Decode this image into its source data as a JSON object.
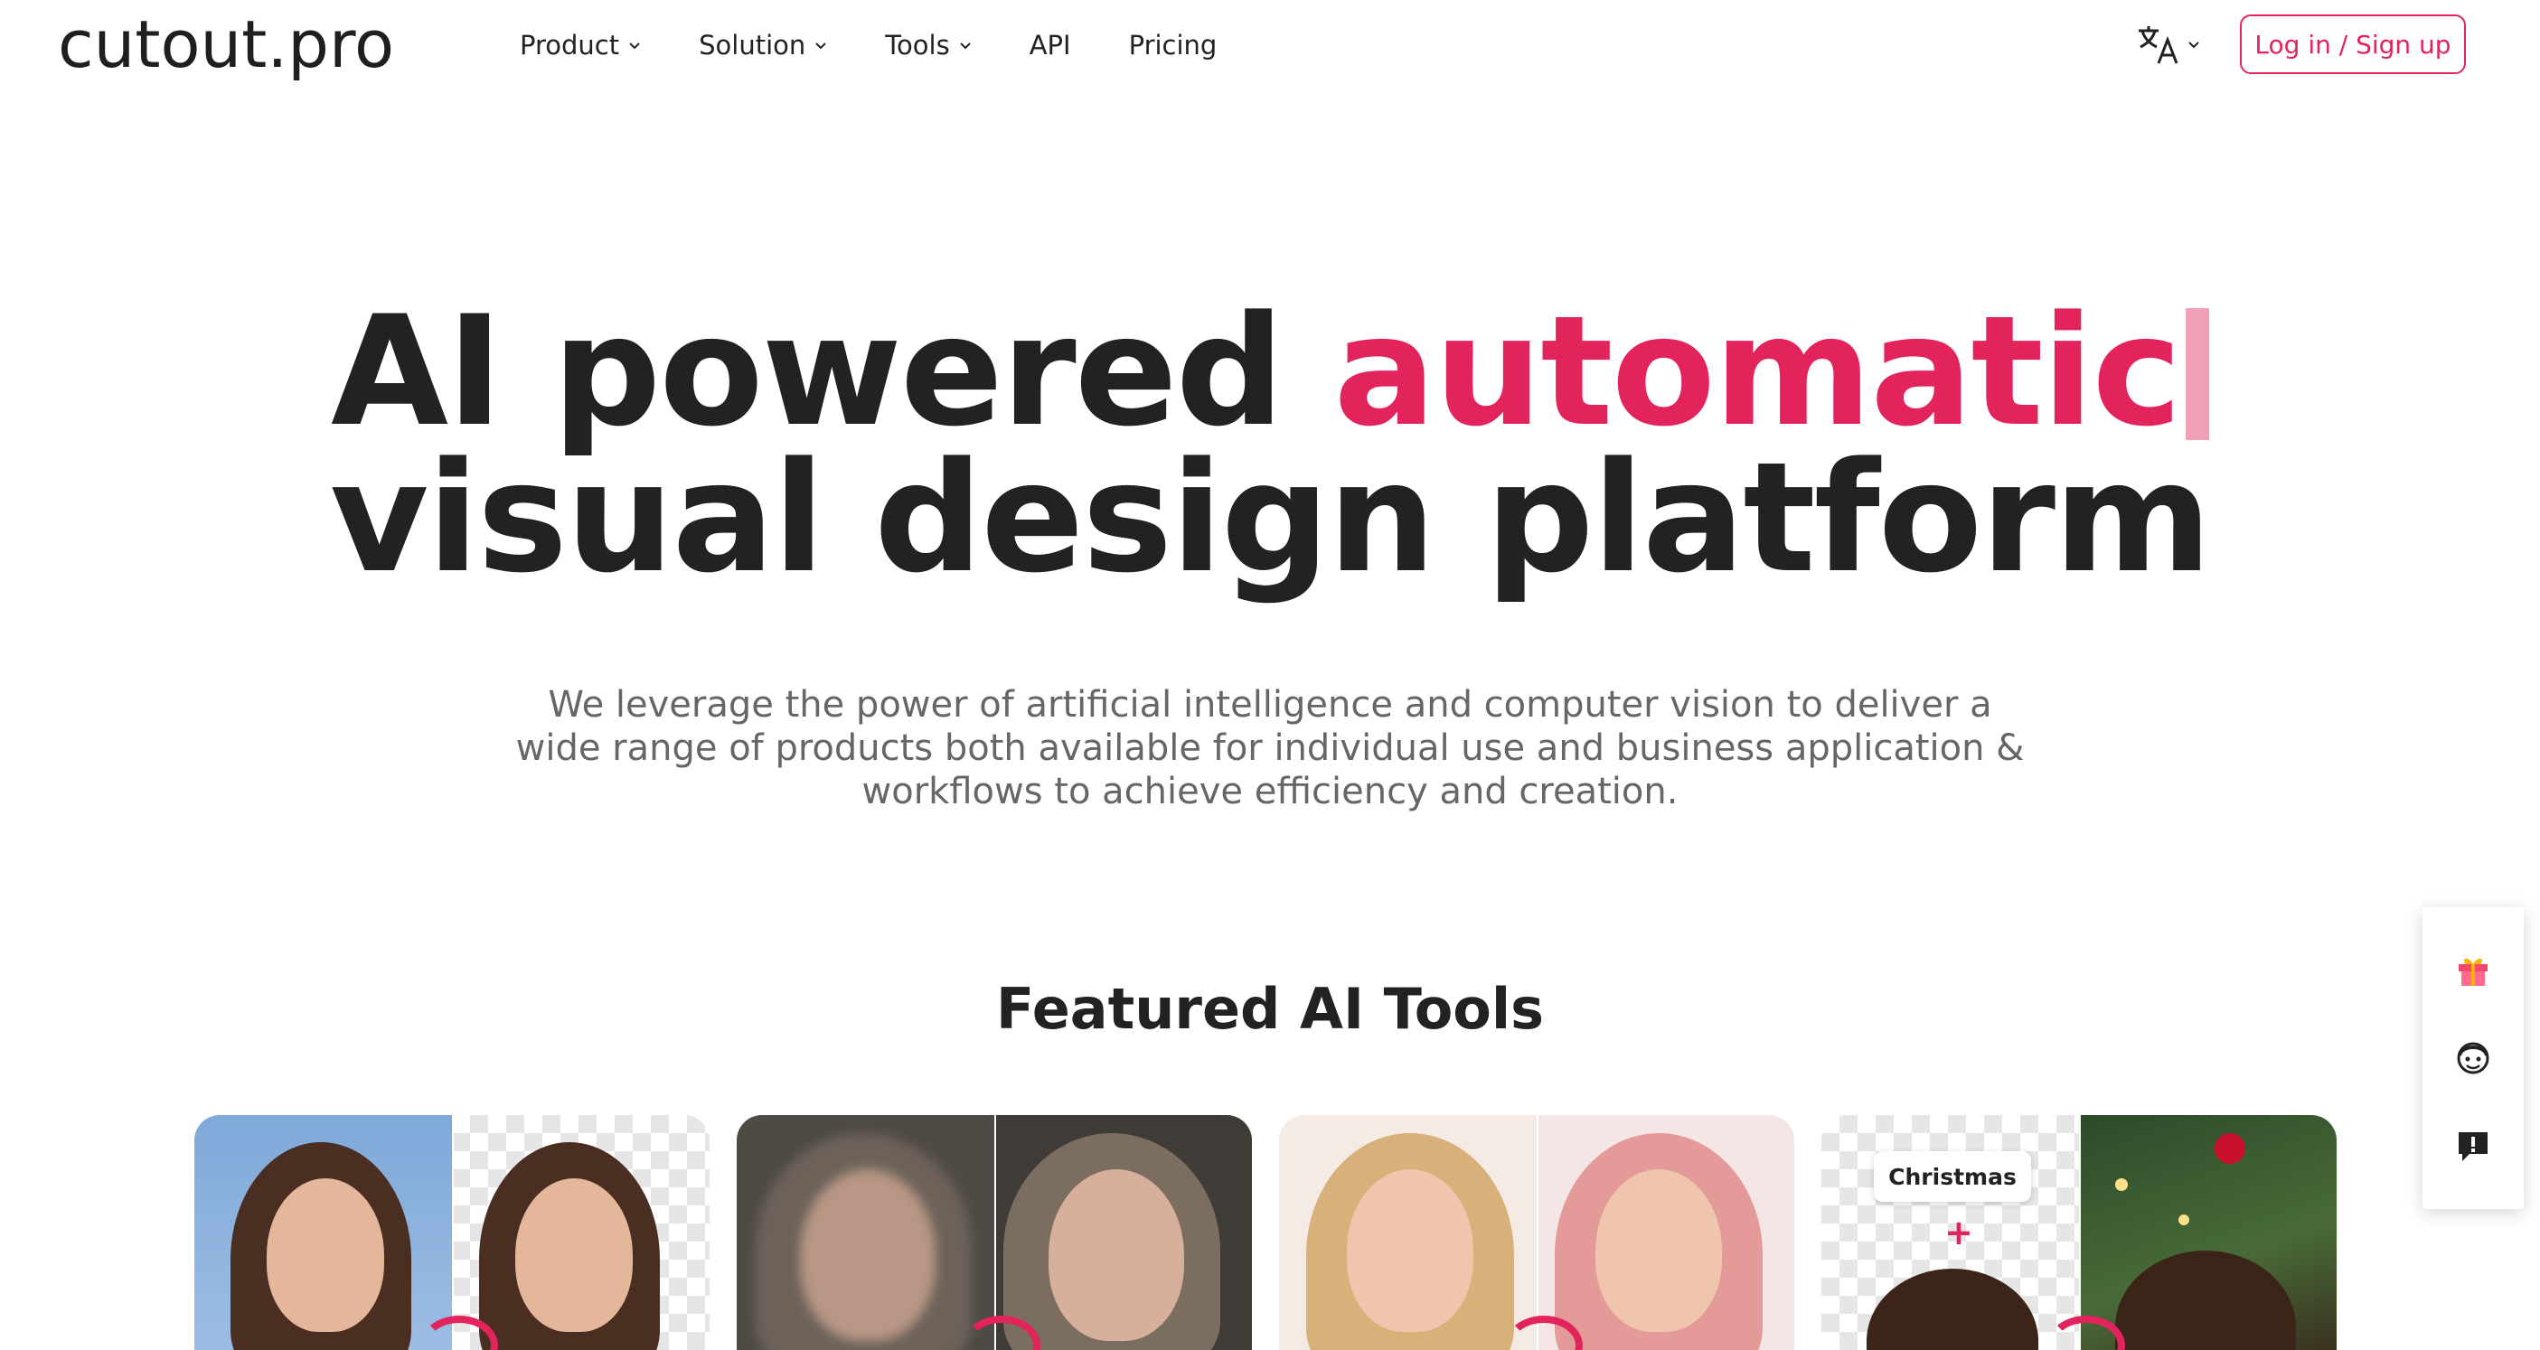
{
  "brand": {
    "logo": "cutout.pro"
  },
  "nav": {
    "items": [
      {
        "label": "Product",
        "has_dropdown": true
      },
      {
        "label": "Solution",
        "has_dropdown": true
      },
      {
        "label": "Tools",
        "has_dropdown": true
      },
      {
        "label": "API",
        "has_dropdown": false
      },
      {
        "label": "Pricing",
        "has_dropdown": false
      }
    ],
    "language_icon": "translate-icon",
    "login_label": "Log in / Sign up"
  },
  "hero": {
    "title_line1_prefix": "AI powered ",
    "title_line1_accent": "automatic",
    "title_line2": "visual design platform",
    "subtitle": "We leverage the power of artificial intelligence and computer vision to deliver a wide range of products both available for individual use and business application & workflows to achieve efficiency and creation."
  },
  "featured": {
    "title": "Featured AI Tools",
    "cards": [
      {
        "icon": "background-remover-preview"
      },
      {
        "icon": "photo-enhancer-preview"
      },
      {
        "icon": "hair-color-preview"
      },
      {
        "icon": "christmas-background-preview",
        "label": "Christmas"
      }
    ]
  },
  "side_widget": {
    "items": [
      "gift-icon",
      "support-agent-icon",
      "feedback-icon"
    ]
  },
  "colors": {
    "accent": "#e3245c",
    "text": "#222222",
    "subtext": "#666666"
  }
}
